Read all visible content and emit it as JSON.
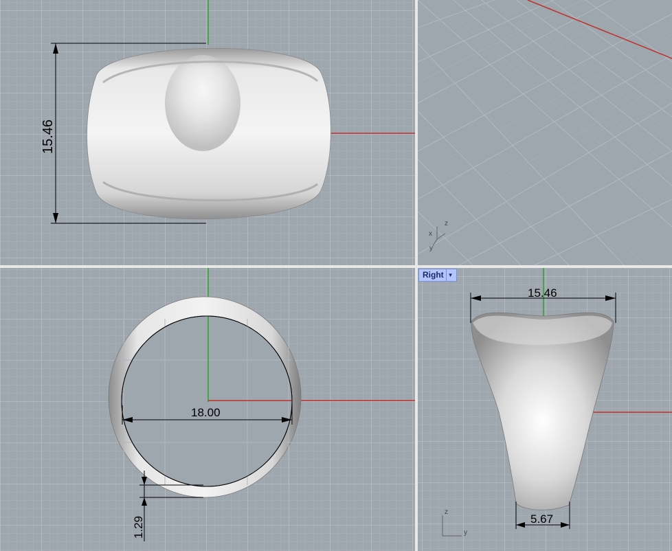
{
  "viewports": {
    "top": {
      "dimension_height": "15.46"
    },
    "perspective": {
      "axis_x": "x",
      "axis_y": "y",
      "axis_z": "z"
    },
    "front": {
      "dimension_diameter": "18.00",
      "dimension_thickness": "1.29"
    },
    "right": {
      "label": "Right",
      "dimension_width": "15.46",
      "dimension_bottom": "5.67",
      "axis_z": "z",
      "axis_y": "y"
    }
  },
  "colors": {
    "viewport_bg": "#9ea6ae",
    "x_axis": "#c0302a",
    "y_axis": "#2ea02e",
    "active_tab": "#b3c4ff"
  }
}
